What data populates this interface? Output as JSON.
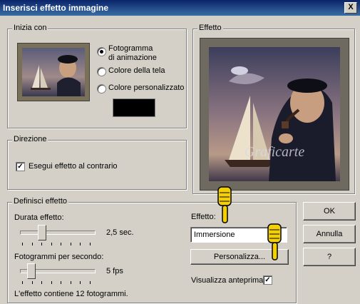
{
  "window": {
    "title": "Inserisci effetto immagine",
    "close_glyph": "X"
  },
  "start": {
    "group_label": "Inizia con",
    "options": [
      {
        "label_line1": "Fotogramma",
        "label_line2": "di animazione",
        "selected": true
      },
      {
        "label": "Colore della tela",
        "selected": false
      },
      {
        "label": "Colore personalizzato",
        "selected": false
      }
    ],
    "custom_color": "#000000"
  },
  "direction": {
    "group_label": "Direzione",
    "reverse_label": "Esegui effetto al contrario",
    "reverse_checked": true,
    "check_glyph": "✓"
  },
  "effect_preview": {
    "group_label": "Effetto",
    "watermark": "Graficarte"
  },
  "define": {
    "group_label": "Definisci effetto",
    "duration_label": "Durata effetto:",
    "duration_value": "2,5 sec.",
    "fps_label": "Fotogrammi per secondo:",
    "fps_value": "5 fps",
    "frames_info": "L'effetto contiene 12 fotogrammi.",
    "effect_label": "Effetto:",
    "effect_selected": "Immersione",
    "customize_label": "Personalizza...",
    "show_preview_label": "Visualizza anteprima",
    "show_preview_checked": true,
    "check_glyph": "✓"
  },
  "buttons": {
    "ok": "OK",
    "cancel": "Annulla",
    "help": "?"
  },
  "colors": {
    "title_bar": "#0a246a",
    "dialog_bg": "#d4d0c8",
    "pointer_hand": "#f5d000"
  }
}
